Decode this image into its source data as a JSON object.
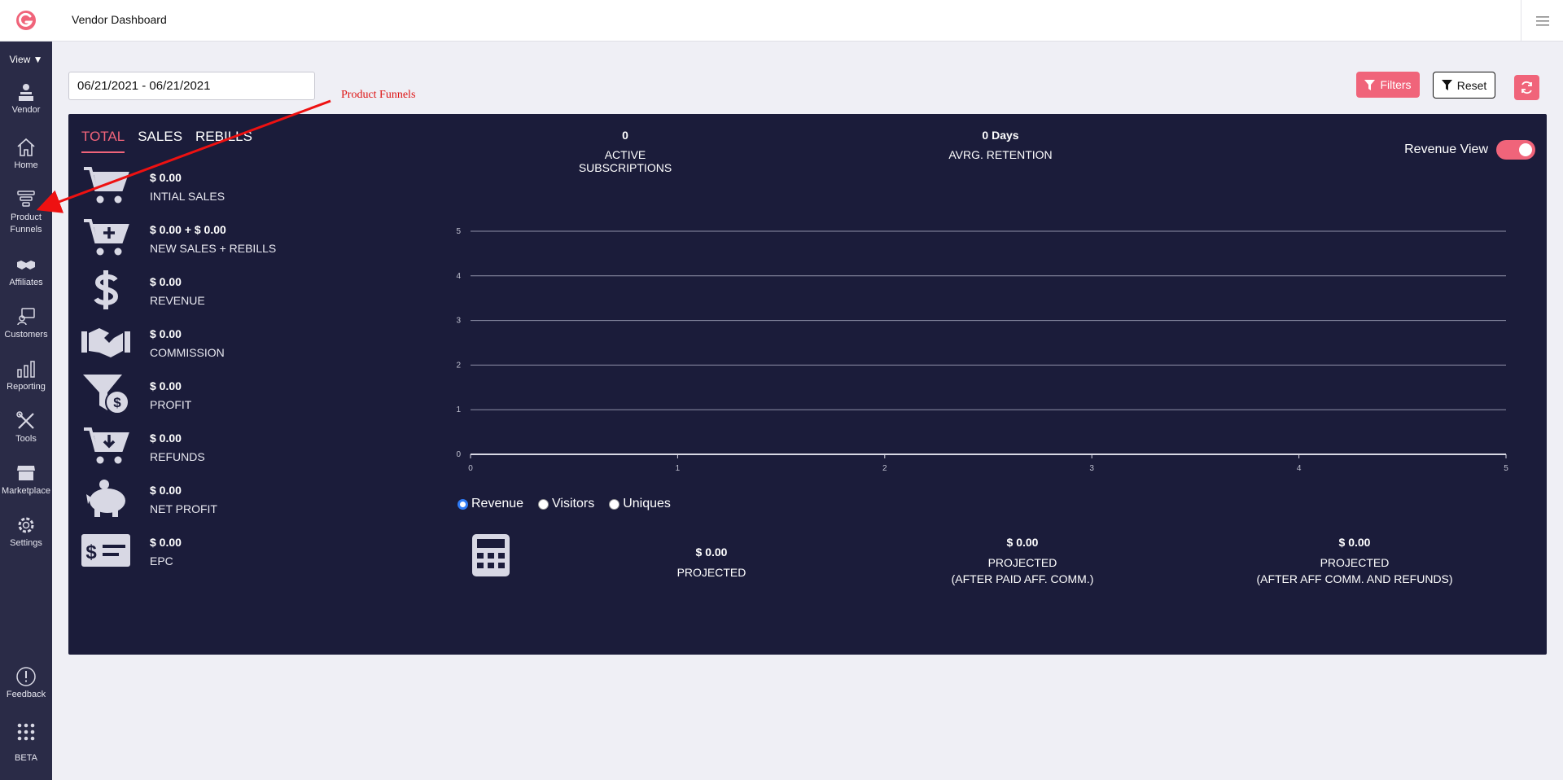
{
  "header": {
    "title": "Vendor Dashboard"
  },
  "sidebar": {
    "view_label": "View ▼",
    "items": [
      {
        "label": "Vendor",
        "icon": "vendor-icon"
      },
      {
        "label": "Home",
        "icon": "home-icon"
      },
      {
        "label": "Product\nFunnels",
        "icon": "funnel-icon"
      },
      {
        "label": "Affiliates",
        "icon": "handshake-icon"
      },
      {
        "label": "Customers",
        "icon": "customers-icon"
      },
      {
        "label": "Reporting",
        "icon": "bar-chart-icon"
      },
      {
        "label": "Tools",
        "icon": "tools-icon"
      },
      {
        "label": "Marketplace",
        "icon": "store-icon"
      },
      {
        "label": "Settings",
        "icon": "gear-icon"
      },
      {
        "label": "Feedback",
        "icon": "exclamation-icon"
      },
      {
        "label": "BETA",
        "icon": "grid-dots-icon"
      }
    ]
  },
  "toolbar": {
    "date_range": "06/21/2021 - 06/21/2021",
    "filters_label": "Filters",
    "reset_label": "Reset"
  },
  "annotation": {
    "text": "Product Funnels"
  },
  "tabs": [
    {
      "label": "TOTAL",
      "active": true
    },
    {
      "label": "SALES",
      "active": false
    },
    {
      "label": "REBILLS",
      "active": false
    }
  ],
  "metrics": [
    {
      "value": "$ 0.00",
      "label": "INTIAL SALES",
      "icon": "cart-icon"
    },
    {
      "value": "$ 0.00 + $ 0.00",
      "label": "NEW SALES + REBILLS",
      "icon": "cart-plus-icon"
    },
    {
      "value": "$ 0.00",
      "label": "REVENUE",
      "icon": "dollar-icon"
    },
    {
      "value": "$ 0.00",
      "label": "COMMISSION",
      "icon": "handshake-icon"
    },
    {
      "value": "$ 0.00",
      "label": "PROFIT",
      "icon": "funnel-dollar-icon"
    },
    {
      "value": "$ 0.00",
      "label": "REFUNDS",
      "icon": "cart-down-icon"
    },
    {
      "value": "$ 0.00",
      "label": "NET PROFIT",
      "icon": "piggy-bank-icon"
    },
    {
      "value": "$ 0.00",
      "label": "EPC",
      "icon": "money-check-icon"
    }
  ],
  "stats": [
    {
      "value": "0",
      "label": "ACTIVE SUBSCRIPTIONS"
    },
    {
      "value": "0 Days",
      "label": "AVRG. RETENTION"
    }
  ],
  "revenue_view": {
    "label": "Revenue View",
    "on": true
  },
  "chart_data": {
    "type": "line",
    "x_ticks": [
      "0",
      "1",
      "2",
      "3",
      "4",
      "5"
    ],
    "y_ticks": [
      "0",
      "1",
      "2",
      "3",
      "4",
      "5"
    ],
    "xlim": [
      0,
      5
    ],
    "ylim": [
      0,
      5
    ],
    "grid": true,
    "series": []
  },
  "radio_options": [
    {
      "label": "Revenue",
      "selected": true
    },
    {
      "label": "Visitors",
      "selected": false
    },
    {
      "label": "Uniques",
      "selected": false
    }
  ],
  "projections": [
    {
      "value": "$ 0.00",
      "label": "PROJECTED",
      "sub": ""
    },
    {
      "value": "$ 0.00",
      "label": "PROJECTED",
      "sub": "(AFTER PAID AFF. COMM.)"
    },
    {
      "value": "$ 0.00",
      "label": "PROJECTED",
      "sub": "(AFTER AFF COMM. AND REFUNDS)"
    }
  ],
  "colors": {
    "accent": "#f0647a",
    "panel": "#1b1c3a",
    "sidebar": "#2a2b47",
    "radio": "#2f7cf6"
  }
}
